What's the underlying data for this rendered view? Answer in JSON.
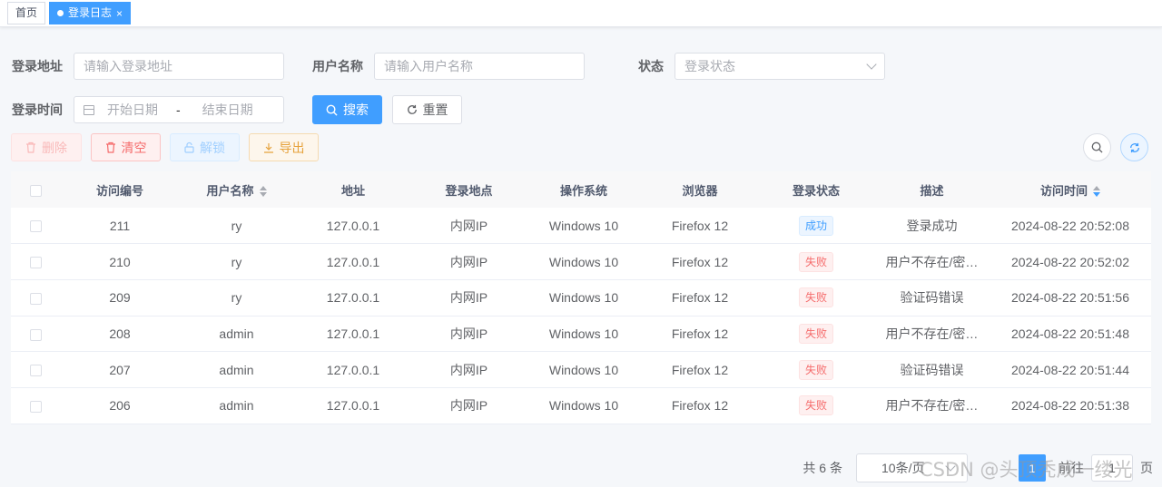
{
  "tabs": [
    {
      "label": "首页",
      "active": false
    },
    {
      "label": "登录日志",
      "active": true
    }
  ],
  "query": {
    "address_label": "登录地址",
    "address_placeholder": "请输入登录地址",
    "username_label": "用户名称",
    "username_placeholder": "请输入用户名称",
    "status_label": "状态",
    "status_placeholder": "登录状态",
    "time_label": "登录时间",
    "start_placeholder": "开始日期",
    "range_separator": "-",
    "end_placeholder": "结束日期",
    "search_label": "搜索",
    "reset_label": "重置"
  },
  "toolbar": {
    "delete_label": "删除",
    "clean_label": "清空",
    "unlock_label": "解锁",
    "export_label": "导出"
  },
  "table": {
    "headers": {
      "id": "访问编号",
      "username": "用户名称",
      "ipaddr": "地址",
      "location": "登录地点",
      "os": "操作系统",
      "browser": "浏览器",
      "status": "登录状态",
      "msg": "描述",
      "time": "访问时间"
    },
    "rows": [
      {
        "id": "211",
        "username": "ry",
        "ipaddr": "127.0.0.1",
        "location": "内网IP",
        "os": "Windows 10",
        "browser": "Firefox 12",
        "status": "成功",
        "status_type": "success",
        "msg": "登录成功",
        "time": "2024-08-22 20:52:08"
      },
      {
        "id": "210",
        "username": "ry",
        "ipaddr": "127.0.0.1",
        "location": "内网IP",
        "os": "Windows 10",
        "browser": "Firefox 12",
        "status": "失败",
        "status_type": "fail",
        "msg": "用户不存在/密…",
        "time": "2024-08-22 20:52:02"
      },
      {
        "id": "209",
        "username": "ry",
        "ipaddr": "127.0.0.1",
        "location": "内网IP",
        "os": "Windows 10",
        "browser": "Firefox 12",
        "status": "失败",
        "status_type": "fail",
        "msg": "验证码错误",
        "time": "2024-08-22 20:51:56"
      },
      {
        "id": "208",
        "username": "admin",
        "ipaddr": "127.0.0.1",
        "location": "内网IP",
        "os": "Windows 10",
        "browser": "Firefox 12",
        "status": "失败",
        "status_type": "fail",
        "msg": "用户不存在/密…",
        "time": "2024-08-22 20:51:48"
      },
      {
        "id": "207",
        "username": "admin",
        "ipaddr": "127.0.0.1",
        "location": "内网IP",
        "os": "Windows 10",
        "browser": "Firefox 12",
        "status": "失败",
        "status_type": "fail",
        "msg": "验证码错误",
        "time": "2024-08-22 20:51:44"
      },
      {
        "id": "206",
        "username": "admin",
        "ipaddr": "127.0.0.1",
        "location": "内网IP",
        "os": "Windows 10",
        "browser": "Firefox 12",
        "status": "失败",
        "status_type": "fail",
        "msg": "用户不存在/密…",
        "time": "2024-08-22 20:51:38"
      }
    ]
  },
  "pagination": {
    "total_text": "共 6 条",
    "page_size": "10条/页",
    "current_page": "1",
    "goto_prefix": "前往",
    "goto_value": "1",
    "goto_suffix": "页"
  },
  "watermark": "CSDN @头顶秃成一缕光",
  "colors": {
    "primary": "#409eff",
    "danger": "#f56c6c",
    "warning": "#e6a23c"
  }
}
